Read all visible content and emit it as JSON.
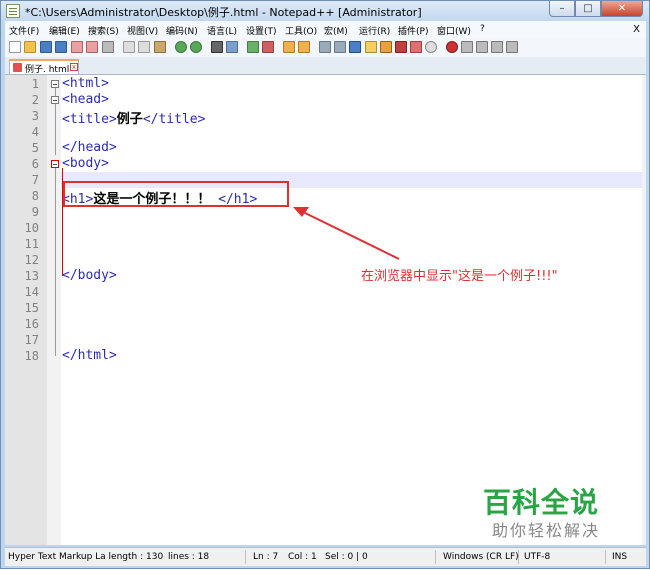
{
  "window": {
    "title": "*C:\\Users\\Administrator\\Desktop\\例子.html - Notepad++ [Administrator]",
    "min_label": "–",
    "max_label": "□",
    "close_label": "✕"
  },
  "menu": {
    "items": [
      "文件(F)",
      "编辑(E)",
      "搜索(S)",
      "视图(V)",
      "编码(N)",
      "语言(L)",
      "设置(T)",
      "工具(O)",
      "宏(M)",
      "运行(R)",
      "插件(P)",
      "窗口(W)",
      "?"
    ],
    "close": "X"
  },
  "tab": {
    "label": "例子. html",
    "close": "x"
  },
  "editor": {
    "line_numbers": [
      "1",
      "2",
      "3",
      "4",
      "5",
      "6",
      "7",
      "8",
      "9",
      "10",
      "11",
      "12",
      "13",
      "14",
      "15",
      "16",
      "17",
      "18"
    ],
    "lines": {
      "l1": "<html>",
      "l2": "<head>",
      "l3_a": "<title>",
      "l3_b": "例子",
      "l3_c": "</title>",
      "l5": "</head>",
      "l6": "<body>",
      "l8_a": "<h1>",
      "l8_b": "这是一个例子！！！",
      "l8_c": " </h1>",
      "l13": "</body>",
      "l18": "</html>"
    }
  },
  "annotation": {
    "text": "在浏览器中显示\"这是一个例子!!!\""
  },
  "status": {
    "file_type": "Hyper Text Markup La length : 130",
    "lines": "lines : 18",
    "ln": "Ln : 7",
    "col": "Col : 1",
    "sel": "Sel : 0 | 0",
    "eol": "Windows (CR LF)",
    "encoding": "UTF-8",
    "mode": "INS"
  },
  "watermark": {
    "main": "百科全说",
    "sub": "助你轻松解决"
  },
  "colors": {
    "tag": "#2c2cb0",
    "annotation": "#e03030",
    "watermark": "#2aa444"
  }
}
